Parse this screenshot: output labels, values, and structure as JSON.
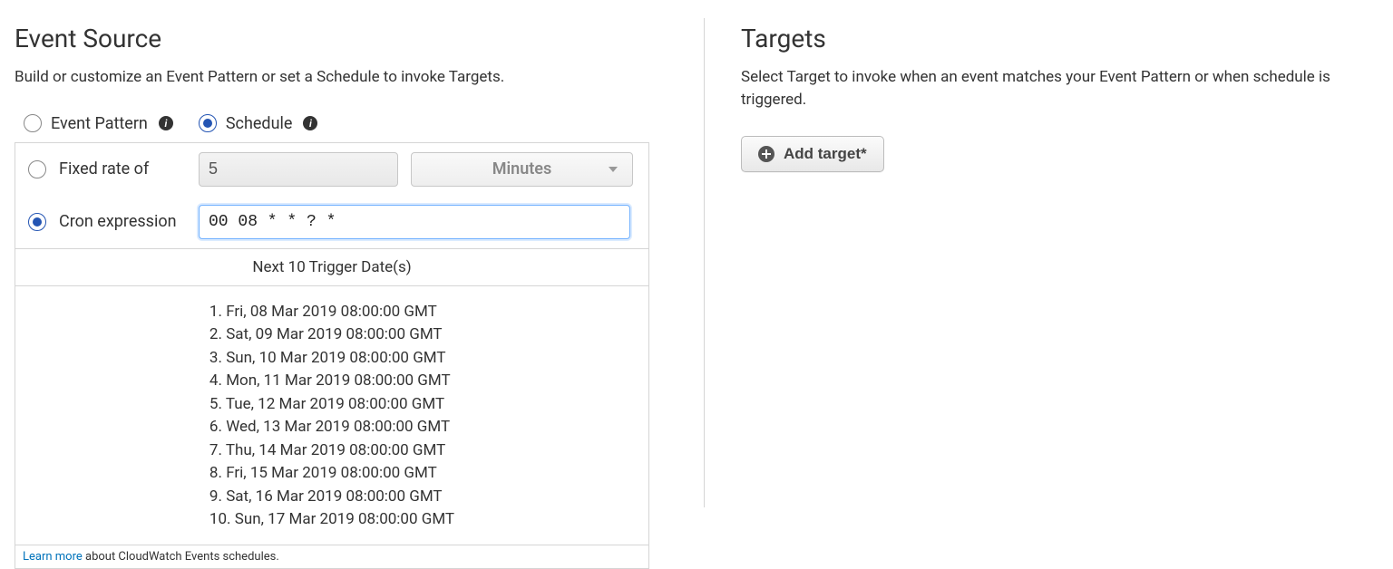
{
  "event_source": {
    "title": "Event Source",
    "description": "Build or customize an Event Pattern or set a Schedule to invoke Targets.",
    "source_type": {
      "options": [
        {
          "label": "Event Pattern",
          "checked": false
        },
        {
          "label": "Schedule",
          "checked": true
        }
      ]
    },
    "schedule": {
      "fixed_rate": {
        "label": "Fixed rate of",
        "value": "5",
        "unit": "Minutes",
        "selected": false
      },
      "cron": {
        "label": "Cron expression",
        "value": "00 08 * * ? *",
        "selected": true
      },
      "trigger_header": "Next 10 Trigger Date(s)",
      "trigger_dates": [
        "Fri, 08 Mar 2019 08:00:00 GMT",
        "Sat, 09 Mar 2019 08:00:00 GMT",
        "Sun, 10 Mar 2019 08:00:00 GMT",
        "Mon, 11 Mar 2019 08:00:00 GMT",
        "Tue, 12 Mar 2019 08:00:00 GMT",
        "Wed, 13 Mar 2019 08:00:00 GMT",
        "Thu, 14 Mar 2019 08:00:00 GMT",
        "Fri, 15 Mar 2019 08:00:00 GMT",
        "Sat, 16 Mar 2019 08:00:00 GMT",
        "Sun, 17 Mar 2019 08:00:00 GMT"
      ],
      "learn_more_link": "Learn more",
      "learn_more_text": " about CloudWatch Events schedules."
    }
  },
  "targets": {
    "title": "Targets",
    "description": "Select Target to invoke when an event matches your Event Pattern or when schedule is triggered.",
    "add_button_label": "Add target*"
  }
}
